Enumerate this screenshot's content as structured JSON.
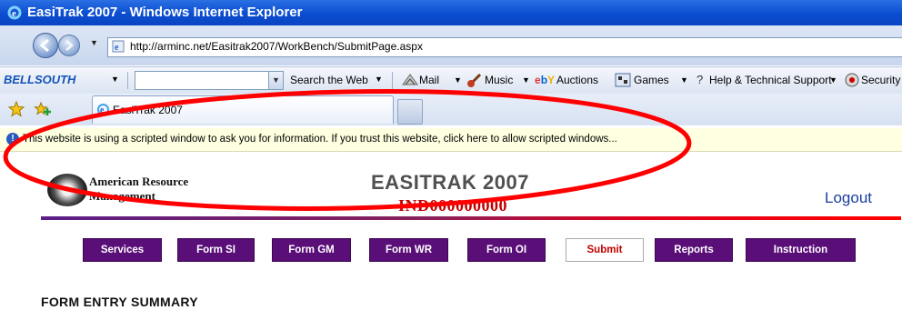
{
  "window": {
    "title": "EasiTrak 2007 - Windows Internet Explorer"
  },
  "address": {
    "url": "http://arminc.net/Easitrak2007/WorkBench/SubmitPage.aspx"
  },
  "toolbar": {
    "brand": "BELLSOUTH",
    "search_label": "Search the Web",
    "items": [
      {
        "label": "Mail",
        "icon": "mail-icon"
      },
      {
        "label": "Music",
        "icon": "guitar-icon"
      },
      {
        "label": "Auctions",
        "prefix": "ebY",
        "icon": "ebay-icon"
      },
      {
        "label": "Games",
        "icon": "games-icon"
      },
      {
        "label": "Help & Technical Support",
        "icon": "help-icon"
      },
      {
        "label": "Security",
        "icon": "security-icon"
      }
    ]
  },
  "tabs": [
    {
      "label": "EasiTrak 2007"
    }
  ],
  "infobar": {
    "text": "This website is using a scripted window to ask you for information. If you trust this website, click here to allow scripted windows..."
  },
  "page": {
    "org_line1": "American Resource",
    "org_line2": "Management",
    "app_title": "EASITRAK 2007",
    "app_id": "IND000000000",
    "logout_label": "Logout",
    "nav": [
      {
        "label": "Services",
        "active": false
      },
      {
        "label": "Form SI",
        "active": false
      },
      {
        "label": "Form GM",
        "active": false
      },
      {
        "label": "Form WR",
        "active": false
      },
      {
        "label": "Form OI",
        "active": false
      },
      {
        "label": "Submit",
        "active": true
      },
      {
        "label": "Reports",
        "active": false
      },
      {
        "label": "Instruction",
        "active": false
      }
    ],
    "section_heading": "FORM ENTRY SUMMARY"
  },
  "colors": {
    "nav_button": "#5a0e78",
    "active_text": "#c00000",
    "annotation": "#ff0000",
    "infobar_bg": "#ffffe1"
  }
}
